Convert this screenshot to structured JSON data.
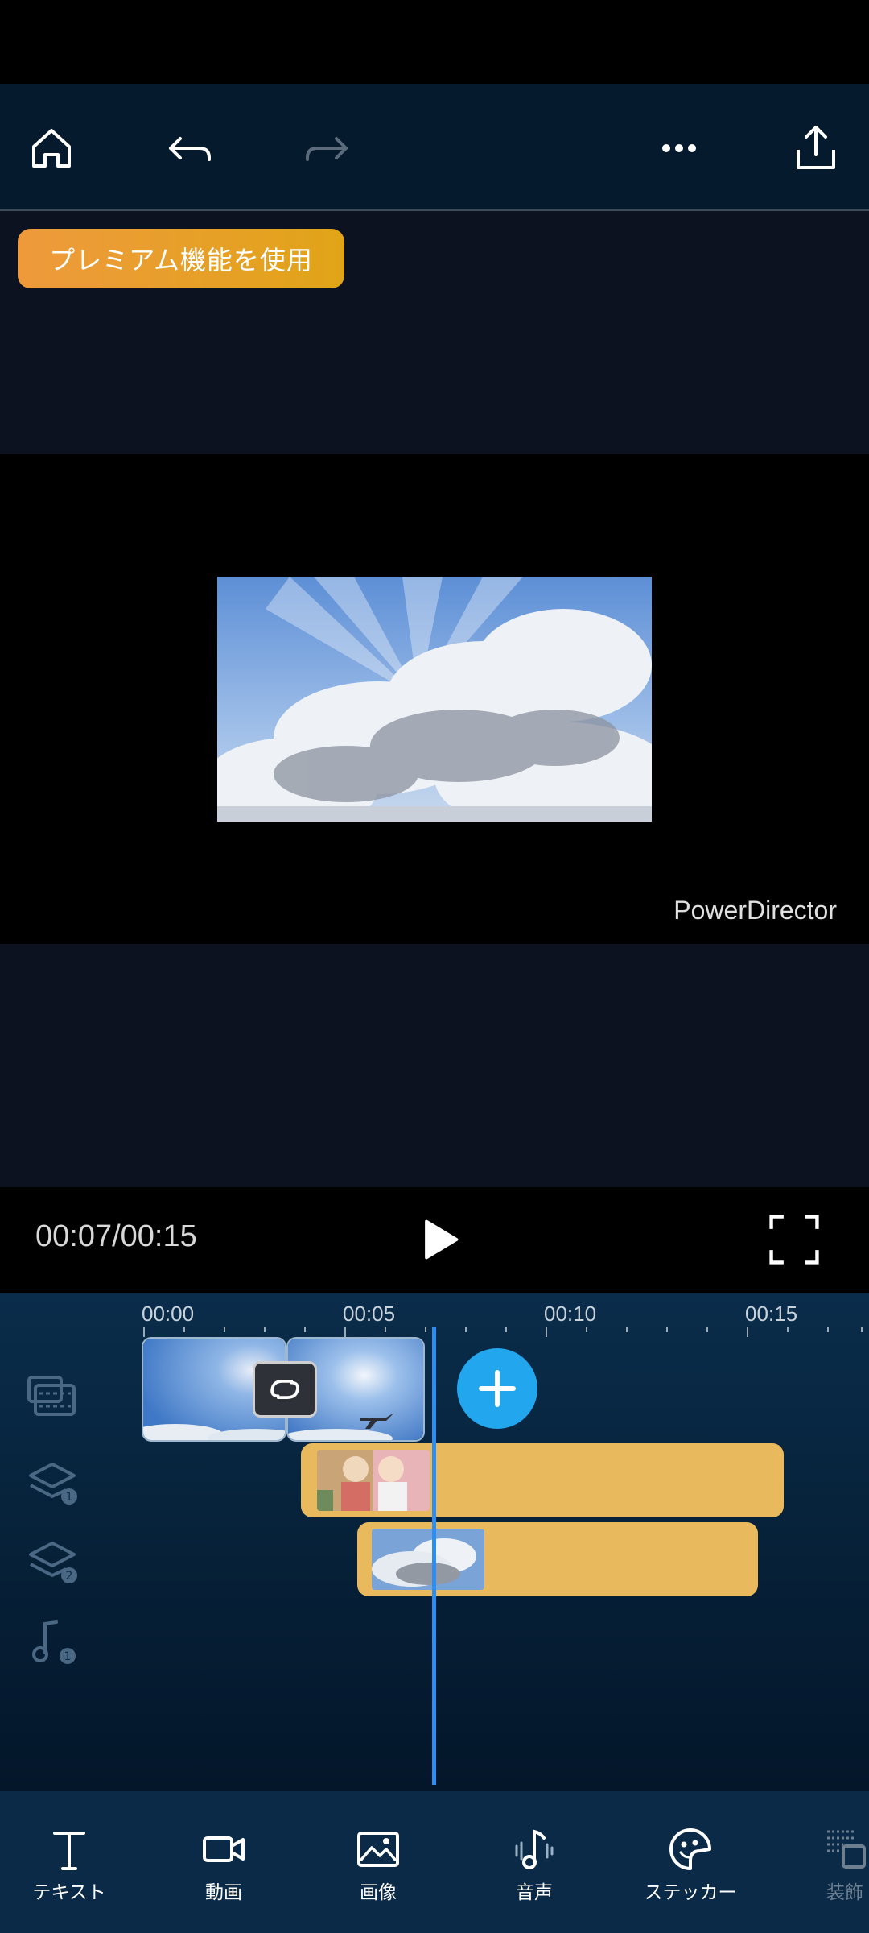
{
  "premium": {
    "label": "プレミアム機能を使用"
  },
  "preview": {
    "watermark": "PowerDirector"
  },
  "playback": {
    "timecode": "00:07/00:15"
  },
  "timeline": {
    "ruler": [
      "00:00",
      "00:05",
      "00:10",
      "00:15"
    ],
    "tracks": [
      {
        "name": "video-track-icon"
      },
      {
        "name": "overlay-layer-1-icon",
        "badge": "1"
      },
      {
        "name": "overlay-layer-2-icon",
        "badge": "2"
      },
      {
        "name": "audio-track-icon",
        "badge": "1"
      }
    ]
  },
  "bottom_bar": {
    "items": [
      {
        "label": "テキスト",
        "icon": "text-icon"
      },
      {
        "label": "動画",
        "icon": "video-camera-icon"
      },
      {
        "label": "画像",
        "icon": "image-icon"
      },
      {
        "label": "音声",
        "icon": "music-note-icon"
      },
      {
        "label": "ステッカー",
        "icon": "sticker-icon"
      },
      {
        "label": "装飾",
        "icon": "decoration-icon"
      }
    ]
  },
  "colors": {
    "accent": "#22a7ee",
    "premium": "#e9a030",
    "overlay_clip": "#e9b95d",
    "playhead": "#2e8df0"
  }
}
